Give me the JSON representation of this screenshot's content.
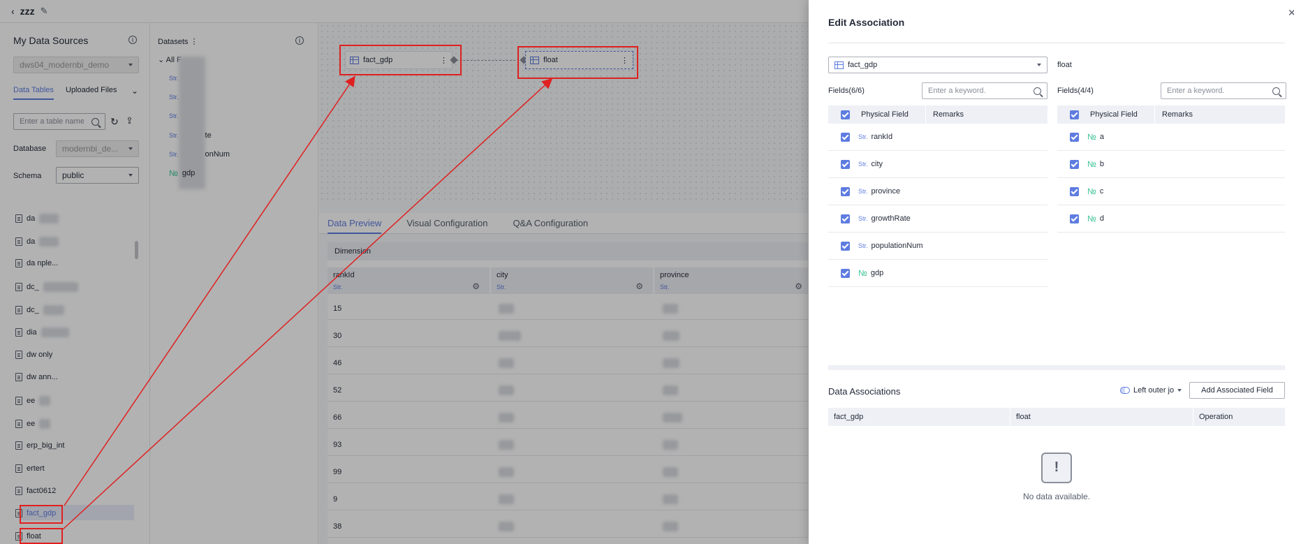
{
  "header": {
    "title": "zzz"
  },
  "left": {
    "title": "My Data Sources",
    "source_select": "dws04_modernbi_demo",
    "tabs": [
      "Data Tables",
      "Uploaded Files"
    ],
    "table_search_placeholder": "Enter a table name",
    "database_label": "Database",
    "database_value": "modernbi_de...",
    "schema_label": "Schema",
    "schema_value": "public",
    "tables": [
      "da",
      "da",
      "da  nple...",
      "dc_",
      "dc_",
      "dia",
      "dw  only",
      "dw  ann...",
      "ee",
      "ee",
      "erp_big_int",
      "ertert",
      "fact0612",
      "fact_gdp",
      "float"
    ]
  },
  "datasets": {
    "title": "Datasets",
    "all_label": "All F",
    "fields": [
      {
        "type": "Str.",
        "name": ""
      },
      {
        "type": "Str.",
        "name": ""
      },
      {
        "type": "Str.",
        "name": ""
      },
      {
        "type": "Str.",
        "name": "te"
      },
      {
        "type": "Str.",
        "name": "onNum"
      },
      {
        "type": "№",
        "name": "gdp"
      }
    ]
  },
  "canvas": {
    "node_left": "fact_gdp",
    "node_right": "float"
  },
  "preview": {
    "tabs": [
      "Data Preview",
      "Visual Configuration",
      "Q&A Configuration"
    ],
    "dimension_label": "Dimension",
    "columns": [
      {
        "name": "rankId",
        "type": "Str."
      },
      {
        "name": "city",
        "type": "Str."
      },
      {
        "name": "province",
        "type": "Str."
      }
    ],
    "rows": [
      "15",
      "30",
      "46",
      "52",
      "66",
      "93",
      "99",
      "9",
      "38"
    ]
  },
  "drawer": {
    "title": "Edit Association",
    "left_table": "fact_gdp",
    "right_table": "float",
    "left_fields_label": "Fields(6/6)",
    "right_fields_label": "Fields(4/4)",
    "search_placeholder": "Enter a keyword.",
    "col_physical": "Physical Field",
    "col_remarks": "Remarks",
    "left_fields": [
      {
        "type": "Str.",
        "name": "rankId"
      },
      {
        "type": "Str.",
        "name": "city"
      },
      {
        "type": "Str.",
        "name": "province"
      },
      {
        "type": "Str.",
        "name": "growthRate"
      },
      {
        "type": "Str.",
        "name": "populationNum"
      },
      {
        "type": "№",
        "name": "gdp"
      }
    ],
    "right_fields": [
      {
        "type": "№",
        "name": "a"
      },
      {
        "type": "№",
        "name": "b"
      },
      {
        "type": "№",
        "name": "c"
      },
      {
        "type": "№",
        "name": "d"
      }
    ],
    "assoc_title": "Data Associations",
    "join_type": "Left outer jo",
    "add_button": "Add Associated Field",
    "assoc_cols": [
      "fact_gdp",
      "float",
      "Operation"
    ],
    "empty_text": "No data available."
  },
  "colors": {
    "accent": "#5e7ce0",
    "highlight": "#e02020",
    "number": "#3ac295"
  }
}
